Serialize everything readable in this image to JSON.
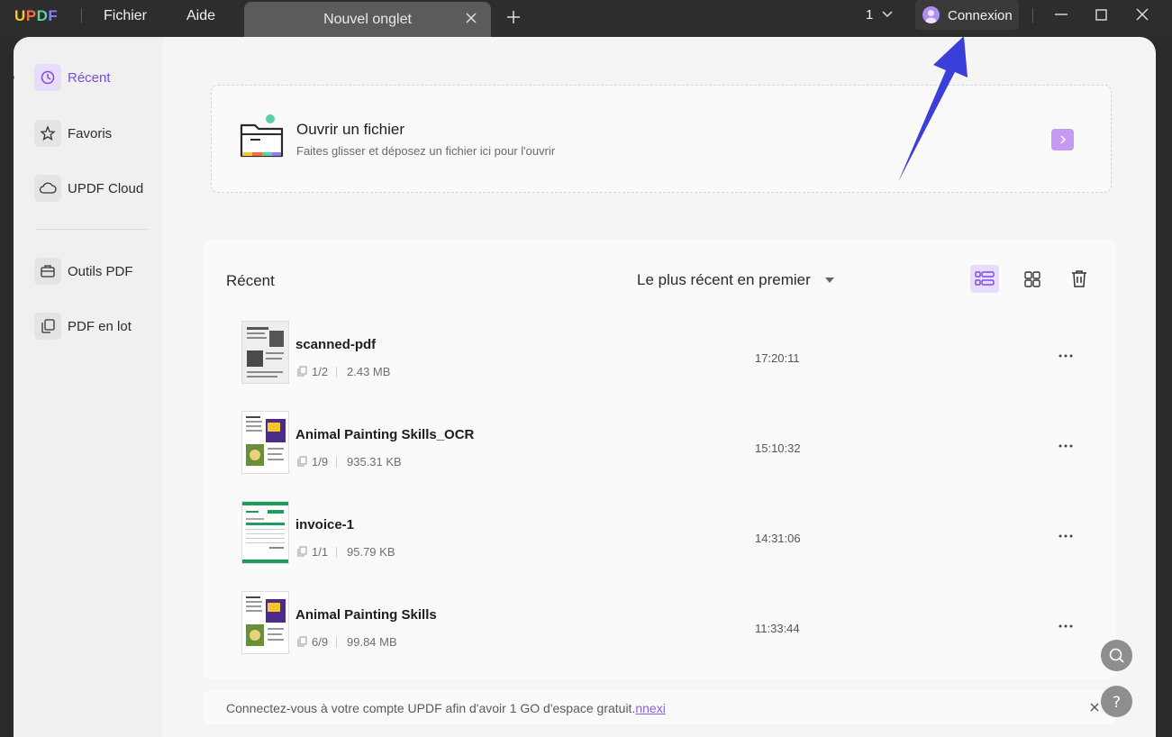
{
  "app": {
    "logo": "UPDF"
  },
  "titlebar": {
    "menus": [
      "Fichier",
      "Aide"
    ],
    "tab_title": "Nouvel onglet",
    "tab_count": "1",
    "connexion_label": "Connexion"
  },
  "sidebar": {
    "items": [
      {
        "label": "Récent",
        "icon": "clock-icon"
      },
      {
        "label": "Favoris",
        "icon": "star-icon"
      },
      {
        "label": "UPDF Cloud",
        "icon": "cloud-icon"
      },
      {
        "label": "Outils PDF",
        "icon": "toolbox-icon"
      },
      {
        "label": "PDF en lot",
        "icon": "batch-icon"
      }
    ]
  },
  "open_file": {
    "title": "Ouvrir un fichier",
    "subtitle": "Faites glisser et déposez un fichier ici pour l'ouvrir"
  },
  "recent": {
    "title": "Récent",
    "sort_label": "Le plus récent en premier",
    "files": [
      {
        "name": "scanned-pdf",
        "pages": "1/2",
        "size": "2.43 MB",
        "time": "17:20:11"
      },
      {
        "name": "Animal Painting Skills_OCR",
        "pages": "1/9",
        "size": "935.31 KB",
        "time": "15:10:32"
      },
      {
        "name": "invoice-1",
        "pages": "1/1",
        "size": "95.79 KB",
        "time": "14:31:06"
      },
      {
        "name": "Animal Painting Skills",
        "pages": "6/9",
        "size": "99.84 MB",
        "time": "11:33:44"
      }
    ]
  },
  "notice": {
    "text": "Connectez-vous à votre compte UPDF afin d'avoir 1 GO d'espace gratuit.",
    "link": "nnexi"
  },
  "colors": {
    "accent": "#7a4be0",
    "accent_light": "#e8dcfb",
    "annotation_arrow": "#3b3fd9"
  }
}
